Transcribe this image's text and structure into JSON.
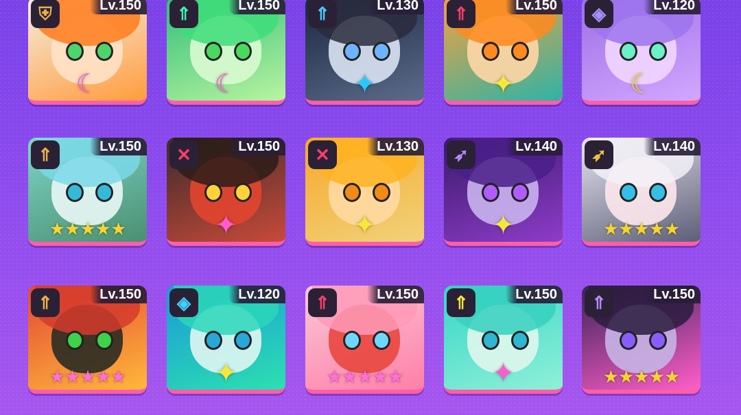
{
  "heroes": [
    {
      "level": "Lv.150",
      "class_icon": "shield-helmet-icon",
      "class_color": "#e8b14a",
      "bg": [
        "#f5efe2",
        "#ff9c3d"
      ],
      "hair": "#ff7b1c",
      "skin": "#ffe2c8",
      "eye": "#4ed36d",
      "emblem": "☾",
      "emblem_color": "#ff5bd0",
      "emblem_kind": "moon-icon"
    },
    {
      "level": "Lv.150",
      "class_icon": "double-arrow-up-icon",
      "class_color": "#3cf0b0",
      "bg": [
        "#2fbf7a",
        "#b9f4a0"
      ],
      "hair": "#3edd7a",
      "skin": "#d9fbd0",
      "eye": "#4ad95e",
      "emblem": "☾",
      "emblem_color": "#ff5bd0",
      "emblem_kind": "moon-icon"
    },
    {
      "level": "Lv.130",
      "class_icon": "double-arrow-up-icon",
      "class_color": "#46c7ff",
      "bg": [
        "#1b2540",
        "#5b6c8a"
      ],
      "hair": "#2a2c3c",
      "skin": "#d9e3f2",
      "eye": "#6db3ff",
      "emblem": "✦",
      "emblem_color": "#27c8ff",
      "emblem_kind": "star-burst-icon"
    },
    {
      "level": "Lv.150",
      "class_icon": "double-arrow-up-icon",
      "class_color": "#ff3d6a",
      "bg": [
        "#f9a13a",
        "#2fb3a6"
      ],
      "hair": "#ff8a1f",
      "skin": "#ffd6a6",
      "eye": "#ff8a1f",
      "emblem": "✦",
      "emblem_color": "#f6e83a",
      "emblem_kind": "star-burst-icon"
    },
    {
      "level": "Lv.120",
      "class_icon": "diamond-rune-icon",
      "class_color": "#a990ff",
      "bg": [
        "#9d6ee6",
        "#d2a7ff"
      ],
      "hair": "#9c74ee",
      "skin": "#f2d6ff",
      "eye": "#6bf0c8",
      "emblem": "☾",
      "emblem_color": "#f5d13a",
      "emblem_kind": "moon-icon"
    },
    {
      "level": "Lv.150",
      "class_icon": "double-arrow-up-icon",
      "class_color": "#e8b14a",
      "bg": [
        "#7fd6c8",
        "#4a8f72"
      ],
      "hair": "#7ad9e9",
      "skin": "#e9f7f5",
      "eye": "#34b9d9",
      "stars": "★★★★★",
      "star_color": "#f5d531"
    },
    {
      "level": "Lv.150",
      "class_icon": "crossed-swords-icon",
      "class_color": "#ff3d6a",
      "bg": [
        "#3b2a2a",
        "#c84a3a"
      ],
      "hair": "#2b1c18",
      "skin": "#e2452f",
      "eye": "#ffd23a",
      "emblem": "✦",
      "emblem_color": "#ff5bd0",
      "emblem_kind": "star-burst-icon"
    },
    {
      "level": "Lv.130",
      "class_icon": "crossed-swords-icon",
      "class_color": "#ff3d6a",
      "bg": [
        "#f7a82a",
        "#f1d27a"
      ],
      "hair": "#ffb321",
      "skin": "#ffd9a1",
      "eye": "#f28a16",
      "emblem": "✦",
      "emblem_color": "#f6e83a",
      "emblem_kind": "star-burst-icon"
    },
    {
      "level": "Lv.140",
      "class_icon": "bow-arrow-icon",
      "class_color": "#b689ff",
      "bg": [
        "#3a1a6a",
        "#8e3cc9"
      ],
      "hair": "#4a1f8a",
      "skin": "#c9b4ee",
      "eye": "#b05cff",
      "emblem": "✦",
      "emblem_color": "#f6e83a",
      "emblem_kind": "star-burst-icon"
    },
    {
      "level": "Lv.140",
      "class_icon": "bow-arrow-icon",
      "class_color": "#f2c53a",
      "bg": [
        "#e7e6f0",
        "#5d5e78"
      ],
      "hair": "#f2f1f7",
      "skin": "#fde8ec",
      "eye": "#33c0e8",
      "stars": "★★★★★",
      "star_color": "#f5d531"
    },
    {
      "level": "Lv.150",
      "class_icon": "double-arrow-up-icon",
      "class_color": "#e8b14a",
      "bg": [
        "#e34834",
        "#ffb83a"
      ],
      "hair": "#d53b2c",
      "skin": "#2a2b22",
      "eye": "#3fd14a",
      "stars": "★★★★★",
      "star_color": "#ff6fd4"
    },
    {
      "level": "Lv.120",
      "class_icon": "diamond-rune-icon",
      "class_color": "#3ed2ff",
      "bg": [
        "#1a9ad8",
        "#2ce0b0"
      ],
      "hair": "#2ad7b8",
      "skin": "#dff6f2",
      "eye": "#28a7d8",
      "emblem": "✦",
      "emblem_color": "#f6e83a",
      "emblem_kind": "star-burst-icon"
    },
    {
      "level": "Lv.150",
      "class_icon": "double-arrow-up-icon",
      "class_color": "#ff3d6a",
      "bg": [
        "#f8c9d8",
        "#ff7fa8"
      ],
      "hair": "#ff9ab8",
      "skin": "#e9473f",
      "eye": "#6fd7ff",
      "stars": "★★★★★",
      "star_color": "#ff6fd4"
    },
    {
      "level": "Lv.150",
      "class_icon": "double-arrow-up-icon",
      "class_color": "#f2e43a",
      "bg": [
        "#37d6c7",
        "#8ff0d8"
      ],
      "hair": "#36d0c0",
      "skin": "#dff6ec",
      "eye": "#2fb6d0",
      "emblem": "✦",
      "emblem_color": "#ff5bd0",
      "emblem_kind": "star-burst-icon"
    },
    {
      "level": "Lv.150",
      "class_icon": "double-arrow-up-icon",
      "class_color": "#b689ff",
      "bg": [
        "#3a2358",
        "#ff5ec9"
      ],
      "hair": "#2a1b3e",
      "skin": "#c7b4e6",
      "eye": "#8a5cff",
      "stars": "★★★★★",
      "star_color": "#f5d531"
    }
  ]
}
